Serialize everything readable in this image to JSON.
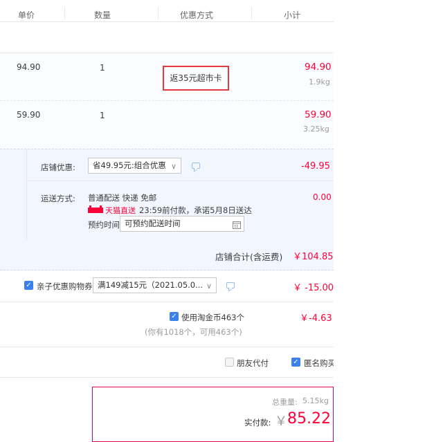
{
  "header": {
    "col_price": "单价",
    "col_qty": "数量",
    "col_promo": "优惠方式",
    "col_subtotal": "小计"
  },
  "items": [
    {
      "price": "94.90",
      "qty": "1",
      "promo": "返35元超市卡",
      "subtotal": "94.90",
      "weight": "1.9kg"
    },
    {
      "price": "59.90",
      "qty": "1",
      "promo": "",
      "subtotal": "59.90",
      "weight": "3.25kg"
    }
  ],
  "shop": {
    "discount_label": "店铺优惠:",
    "discount_select": "省49.95元:组合优惠",
    "discount_amount": "-49.95",
    "shipping_label": "运送方式:",
    "shipping_method": "普通配送 快递 免邮",
    "tmall_direct": "天猫直送",
    "delivery_promise": "23:59前付款，承诺5月8日送达",
    "reserve_label": "预约时间",
    "reserve_placeholder": "可预约配送时间",
    "shipping_amount": "0.00",
    "total_label": "店铺合计(含运费)",
    "total_amount": "￥104.85"
  },
  "coupon": {
    "label": "亲子优惠购物券",
    "select": "满149减15元（2021.05.0...",
    "amount": "￥ -15.00"
  },
  "coins": {
    "label": "使用淘金币463个",
    "note": "(你有1018个，可用463个)",
    "amount": "￥-4.63"
  },
  "options": {
    "friend_pay": "朋友代付",
    "anonymous": "匿名购买"
  },
  "summary": {
    "weight_label": "总重量:",
    "weight_value": "5.15kg",
    "pay_label": "实付款:",
    "currency": "￥",
    "pay_amount": "85.22"
  },
  "colors": {
    "accent_red": "#ff0036",
    "checkbox_blue": "#3c80ee",
    "shop_bg": "#f2f7ff"
  }
}
